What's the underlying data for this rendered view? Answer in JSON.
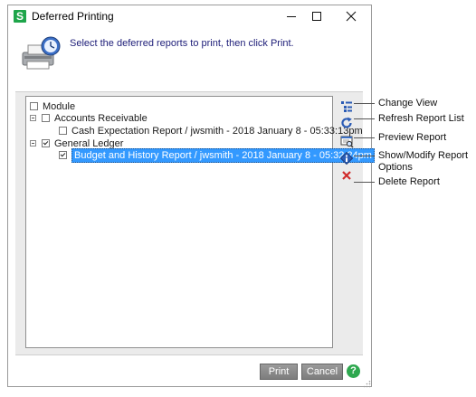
{
  "window": {
    "title": "Deferred Printing",
    "app_icon_letter": "S",
    "minimize_icon": "minimize-icon",
    "maximize_icon": "maximize-icon",
    "close_icon": "close-icon"
  },
  "header": {
    "icon": "printer-clock-icon",
    "instruction": "Select the deferred reports to print, then click Print."
  },
  "tree": {
    "root": {
      "label": "Module",
      "checked": false
    },
    "groups": [
      {
        "label": "Accounts Receivable",
        "checked": false,
        "reports": [
          {
            "label": "Cash Expectation Report  /  jwsmith - 2018 January 8 - 05:33:13pm",
            "checked": false,
            "selected": false
          }
        ]
      },
      {
        "label": "General Ledger",
        "checked": true,
        "reports": [
          {
            "label": "Budget and History Report  /  jwsmith - 2018 January 8 - 05:32:24pm",
            "checked": true,
            "selected": true
          }
        ]
      }
    ]
  },
  "side_buttons": [
    {
      "icon": "change-view-icon",
      "callout": "Change View"
    },
    {
      "icon": "refresh-icon",
      "callout": "Refresh Report List"
    },
    {
      "icon": "preview-icon",
      "callout": "Preview Report"
    },
    {
      "icon": "report-options-icon",
      "callout": "Show/Modify Report",
      "callout2": "Options"
    },
    {
      "icon": "delete-icon",
      "callout": "Delete Report"
    }
  ],
  "footer": {
    "print_label": "Print",
    "cancel_label": "Cancel",
    "help_label": "?"
  },
  "colors": {
    "selection": "#3399ff",
    "app_green": "#1ea54a",
    "instruction_text": "#20207a"
  }
}
